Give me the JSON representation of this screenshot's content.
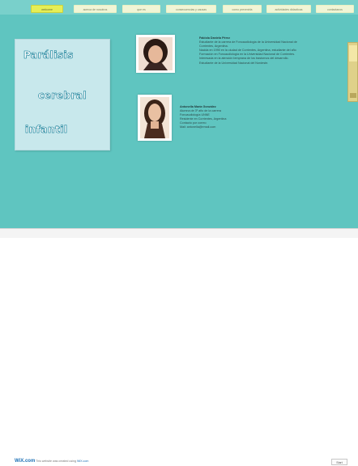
{
  "nav": {
    "tabs": [
      {
        "label": "welcome",
        "active": true
      },
      {
        "label": "acerca de nosotros",
        "active": false
      },
      {
        "label": "que es",
        "active": false
      },
      {
        "label": "consecuencias y causas",
        "active": false
      },
      {
        "label": "como prevenirla",
        "active": false
      },
      {
        "label": "actividades didacticas",
        "active": false
      },
      {
        "label": "contactanos",
        "active": false
      }
    ]
  },
  "panel": {
    "title_words": [
      "Parálisis",
      "cerebral",
      "infantil"
    ]
  },
  "bios": [
    {
      "name": "Fabiola Daniela Pérez",
      "lines": [
        "Estudiante de la carrera de Fonoaudiología de la Universidad Nacional de",
        "Corrientes, Argentina.",
        "Nacida en 1990 en la ciudad de Corrientes, Argentina, estudiante del año",
        "Formación en Fonoaudiología en la Universidad Nacional de Corrientes.",
        "Interesada en la atención temprana de los trastornos del desarrollo.",
        "Estudiante de la Universidad Nacional del Nordeste."
      ]
    },
    {
      "name": "Antonella María González",
      "lines": [
        "Alumna de 3º año de la carrera",
        "Fonoaudiología UNNE",
        "Residente en Corrientes, Argentina",
        "Contacto por correo",
        "Mail: antonella@email.com"
      ]
    }
  ],
  "footer": {
    "brand": "WiX.com",
    "text": "This website was created using",
    "link": "WiX.com",
    "button": "Start"
  },
  "colors": {
    "background": "#5fc5c0",
    "active_tab": "#e6ee56",
    "panel": "#c8e8ec"
  }
}
